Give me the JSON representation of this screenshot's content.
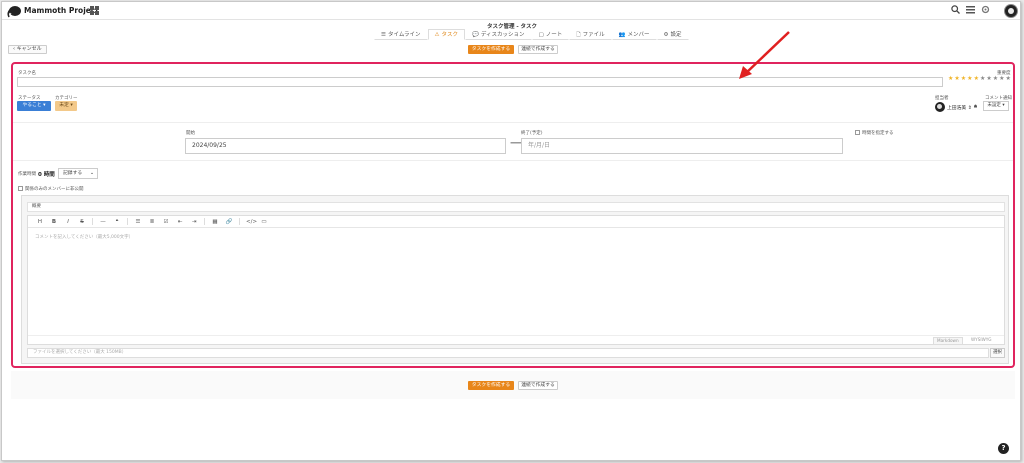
{
  "header": {
    "brand": "Mammoth Project",
    "search_icon": "search-icon",
    "menu_icon": "list-icon",
    "gear_icon": "gear-icon"
  },
  "page_title": "タスク管理 - タスク",
  "tabs": [
    {
      "icon": "☰",
      "label": "タイムライン"
    },
    {
      "icon": "⚠",
      "label": "タスク"
    },
    {
      "icon": "💬",
      "label": "ディスカッション"
    },
    {
      "icon": "▢",
      "label": "ノート"
    },
    {
      "icon": "🗋",
      "label": "ファイル"
    },
    {
      "icon": "👥",
      "label": "メンバー"
    },
    {
      "icon": "⚙",
      "label": "設定"
    }
  ],
  "actions": {
    "cancel": "‹ キャンセル",
    "create": "タスクを作成する",
    "create_continue": "連続で作成する"
  },
  "form": {
    "task_name_label": "タスク名",
    "importance_label": "重要度",
    "importance_stars": 5,
    "importance_max": 10,
    "status_label": "ステータス",
    "status_value": "やること ▾",
    "category_label": "カテゴリー",
    "category_value": "未定 ▾",
    "assignee_label": "担当者",
    "assignee_name": "上田浩美 ⇕",
    "notification_label": "コメント通知",
    "notification_value": "未設定 ▾",
    "start_label": "開始",
    "start_value": "2024/09/25",
    "end_label": "終了(予定)",
    "end_placeholder": "年/月/日",
    "time_specify_label": "時間を指定する",
    "work_time_label": "作業時間",
    "work_time_value": "0 時間",
    "work_time_select": "記録する",
    "share_label": "関係のみのメンバーに非公開"
  },
  "editor": {
    "tab_label": "概要",
    "placeholder": "コメントを記入してください（最大5,000文字）",
    "mode_markdown": "Markdown",
    "mode_wysiwyg": "WYSIWYG",
    "file_placeholder": "ファイルを選択してください（最大 150MB）",
    "file_button": "選択"
  },
  "colors": {
    "accent": "#e8861a",
    "status_blue": "#3a7fd6",
    "highlight": "#e0245e",
    "star_on": "#f0b429",
    "star_off": "#888888"
  }
}
